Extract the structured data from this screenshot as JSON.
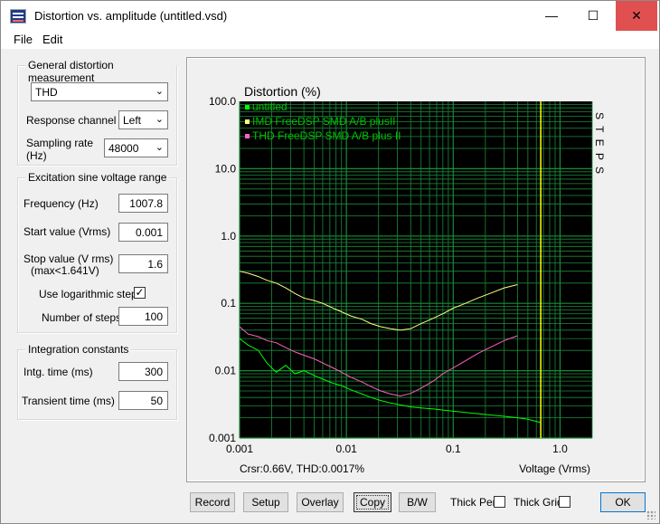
{
  "window": {
    "title": "Distortion vs. amplitude (untitled.vsd)",
    "icon": "app-icon",
    "minimize": "—",
    "maximize": "☐",
    "close": "✕"
  },
  "menu": {
    "file": "File",
    "edit": "Edit"
  },
  "general": {
    "title": "General distortion measurement",
    "measurement": "THD",
    "response_label": "Response channel",
    "response_value": "Left",
    "sampling_label_1": "Sampling rate",
    "sampling_label_2": "(Hz)",
    "sampling_value": "48000"
  },
  "excitation": {
    "title": "Excitation sine voltage range",
    "frequency_label": "Frequency (Hz)",
    "frequency_value": "1007.8",
    "start_label": "Start value (Vrms)",
    "start_value": "0.001",
    "stop_label_1": "Stop value (V rms)",
    "stop_label_2": "(max<1.641V)",
    "stop_value": "1.6",
    "log_label": "Use logarithmic steps",
    "log_checked": "✓",
    "steps_label": "Number of steps",
    "steps_value": "100"
  },
  "integration": {
    "title": "Integration constants",
    "intg_label": "Intg. time (ms)",
    "intg_value": "300",
    "transient_label": "Transient time (ms)",
    "transient_value": "50"
  },
  "buttons": {
    "record": "Record",
    "setup": "Setup",
    "overlay": "Overlay",
    "copy": "Copy",
    "bw": "B/W",
    "thick_pen": "Thick Pen",
    "thick_grid": "Thick Grid",
    "ok": "OK"
  },
  "chart_data": {
    "type": "line",
    "title": "Distortion (%)",
    "xlabel": "Voltage (Vrms)",
    "ylabel": "",
    "x_scale": "log",
    "y_scale": "log",
    "xlim": [
      0.001,
      2
    ],
    "ylim": [
      0.001,
      100
    ],
    "x_ticks": [
      "0.001",
      "0.01",
      "0.1",
      "1.0"
    ],
    "y_ticks": [
      "0.001",
      "0.01",
      "0.1",
      "1.0",
      "10.0",
      "100.0"
    ],
    "grid": true,
    "background": "#000000",
    "grid_color": "#1a8a3a",
    "legend_position": "top-left",
    "side_label": "S T E P S",
    "cursor_readout": "Crsr:0.66V, THD:0.0017%",
    "cursor_x": 0.66,
    "series": [
      {
        "name": "untitled",
        "color": "#00ff00",
        "x": [
          0.001,
          0.0012,
          0.0015,
          0.0018,
          0.0022,
          0.0027,
          0.0033,
          0.004,
          0.005,
          0.006,
          0.0075,
          0.009,
          0.011,
          0.014,
          0.017,
          0.021,
          0.026,
          0.032,
          0.04,
          0.05,
          0.065,
          0.08,
          0.1,
          0.13,
          0.17,
          0.22,
          0.3,
          0.4,
          0.5,
          0.66
        ],
        "y": [
          0.03,
          0.024,
          0.02,
          0.013,
          0.0095,
          0.012,
          0.009,
          0.01,
          0.0085,
          0.0075,
          0.0065,
          0.006,
          0.0052,
          0.0045,
          0.004,
          0.0036,
          0.0033,
          0.0031,
          0.0029,
          0.0028,
          0.0027,
          0.0026,
          0.0025,
          0.0024,
          0.0023,
          0.0022,
          0.0021,
          0.002,
          0.0019,
          0.0017
        ]
      },
      {
        "name": "IMD FreeDSP SMD A/B plusII",
        "color": "#ffff80",
        "x": [
          0.001,
          0.0012,
          0.0015,
          0.0018,
          0.0022,
          0.0027,
          0.0033,
          0.004,
          0.005,
          0.006,
          0.0075,
          0.009,
          0.011,
          0.014,
          0.017,
          0.021,
          0.026,
          0.032,
          0.04,
          0.05,
          0.065,
          0.08,
          0.1,
          0.13,
          0.17,
          0.22,
          0.3,
          0.4
        ],
        "y": [
          0.3,
          0.28,
          0.25,
          0.22,
          0.2,
          0.17,
          0.14,
          0.12,
          0.11,
          0.1,
          0.085,
          0.075,
          0.065,
          0.058,
          0.05,
          0.045,
          0.042,
          0.04,
          0.042,
          0.05,
          0.06,
          0.07,
          0.085,
          0.1,
          0.12,
          0.14,
          0.17,
          0.19
        ]
      },
      {
        "name": "THD FreeDSP SMD A/B plus II",
        "color": "#ff60c0",
        "x": [
          0.001,
          0.0012,
          0.0015,
          0.0018,
          0.0022,
          0.0027,
          0.0033,
          0.004,
          0.005,
          0.006,
          0.0075,
          0.009,
          0.011,
          0.014,
          0.017,
          0.021,
          0.026,
          0.032,
          0.04,
          0.05,
          0.065,
          0.08,
          0.1,
          0.13,
          0.17,
          0.22,
          0.3,
          0.4
        ],
        "y": [
          0.045,
          0.035,
          0.032,
          0.028,
          0.026,
          0.022,
          0.019,
          0.017,
          0.015,
          0.013,
          0.011,
          0.0095,
          0.008,
          0.0068,
          0.0058,
          0.005,
          0.0045,
          0.0042,
          0.0046,
          0.0055,
          0.007,
          0.009,
          0.011,
          0.014,
          0.018,
          0.022,
          0.028,
          0.033
        ]
      }
    ]
  }
}
